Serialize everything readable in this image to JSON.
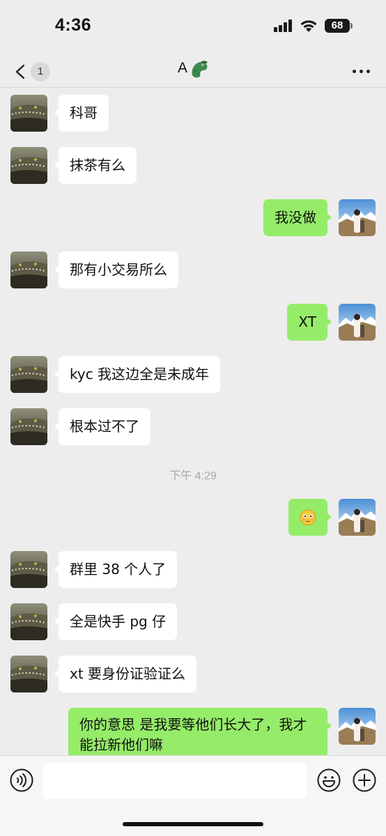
{
  "status_bar": {
    "time": "4:36",
    "battery": "68"
  },
  "nav": {
    "unread_count": "1",
    "title": "A",
    "title_emoji": "crocodile-icon"
  },
  "messages": [
    {
      "side": "in",
      "text": "科哥"
    },
    {
      "side": "in",
      "text": "抹茶有么"
    },
    {
      "side": "out",
      "text": "我没做"
    },
    {
      "side": "in",
      "text": "那有小交易所么"
    },
    {
      "side": "out",
      "text": "XT"
    },
    {
      "side": "in",
      "text": "kyc 我这边全是未成年"
    },
    {
      "side": "in",
      "text": "根本过不了"
    },
    {
      "side": "out",
      "text": "😳"
    },
    {
      "side": "in",
      "text": "群里 38 个人了"
    },
    {
      "side": "in",
      "text": "全是快手 pg 仔"
    },
    {
      "side": "in",
      "text": "xt 要身份证验证么"
    },
    {
      "side": "out",
      "text": "你的意思 是我要等他们长大了，我才能拉新他们嘛"
    }
  ],
  "timestamp": "下午 4:29",
  "input": {
    "placeholder": ""
  },
  "colors": {
    "incoming_bubble": "#ffffff",
    "outgoing_bubble": "#95ec69",
    "background": "#ededed"
  }
}
